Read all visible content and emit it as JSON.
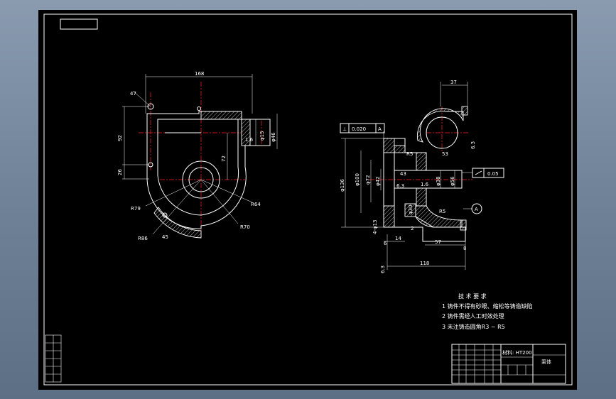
{
  "drawing": {
    "left_view_dims": {
      "d168": "168",
      "d47": "47",
      "d92": "92",
      "d26": "26",
      "d72": "72",
      "d1_6": "1.6",
      "d_phi15": "φ15",
      "d_phi46": "φ46",
      "r79a": "R79",
      "r64": "R64",
      "r70": "R70",
      "r86": "R86",
      "a45": "45"
    },
    "right_view_dims": {
      "d37": "37",
      "d6_3a": "6.3",
      "perp_tol": "⊥",
      "perp_value": "0.020",
      "perp_datum": "A",
      "r5a": "R5",
      "d53": "53",
      "d43": "43",
      "d_phi136": "φ136",
      "d_phi100": "φ100",
      "d_phi72": "φ72",
      "d_phi42": "φ42",
      "d_phi38": "φ38",
      "d_phi56": "φ56",
      "d6_3b": "6.3",
      "d1_6b": "1.6",
      "flat_value": "0.05",
      "d_phi30": "φ30",
      "r5b": "R5",
      "datum_a": "A",
      "d4_phi13": "4-φ13",
      "d2": "2",
      "d57": "57",
      "d6": "6",
      "d14": "14",
      "d118": "118",
      "d8": "8",
      "d6_3c": "6.3"
    },
    "notes": {
      "title": "技 术 要 求",
      "items": [
        "1  铸件不得有砂眼、缩松等铸造缺陷",
        "2  铸件需经人工时效处理",
        "3  未注铸造圆角R3 ~ R5"
      ]
    },
    "title_block": {
      "material": "材料: HT200",
      "part_name": "泵体"
    }
  },
  "colors": {
    "background": "#000000",
    "line": "#ffffff",
    "center_line": "#ff2020",
    "frame_outer": "#7f90a6"
  }
}
